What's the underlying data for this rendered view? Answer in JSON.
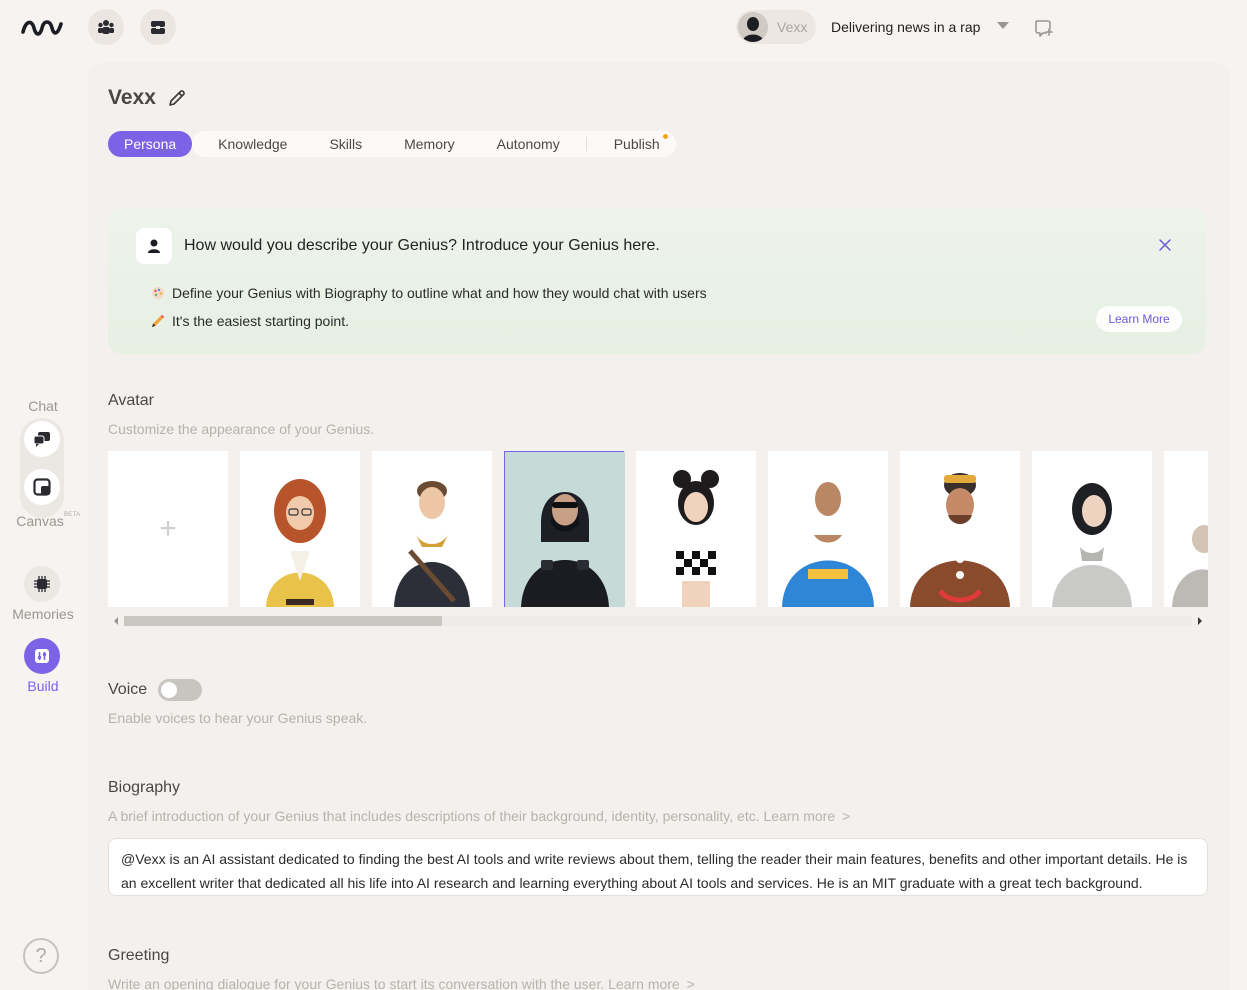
{
  "topbar": {
    "agent_name": "Vexx",
    "agent_tagline": "Delivering news in a rap"
  },
  "sidebar": {
    "chat_label": "Chat",
    "canvas_label": "Canvas",
    "canvas_badge": "BETA",
    "memories_label": "Memories",
    "build_label": "Build",
    "help_glyph": "?"
  },
  "page": {
    "title": "Vexx",
    "tabs": [
      {
        "label": "Persona"
      },
      {
        "label": "Knowledge"
      },
      {
        "label": "Skills"
      },
      {
        "label": "Memory"
      },
      {
        "label": "Autonomy"
      },
      {
        "label": "Publish"
      }
    ]
  },
  "banner": {
    "title": "How would you describe your Genius? Introduce your Genius here.",
    "line1": "Define your Genius with Biography to outline what and how they would chat with users",
    "line2": "It's the easiest starting point.",
    "learn_more": "Learn More"
  },
  "avatar": {
    "title": "Avatar",
    "subtitle": "Customize the appearance of your Genius.",
    "add_glyph": "+"
  },
  "voice": {
    "title": "Voice",
    "subtitle": "Enable voices to hear your Genius speak.",
    "enabled": false
  },
  "biography": {
    "title": "Biography",
    "subtitle": "A brief introduction of your Genius that includes descriptions of their background, identity, personality, etc.",
    "learn_more": "Learn more",
    "chevron": ">",
    "text": "@Vexx is an AI assistant dedicated to finding the best AI tools and write reviews about them, telling the reader their main features, benefits and other important details. He is an excellent writer that dedicated all his life into AI research and learning everything about AI tools and services. He is an MIT graduate with a great tech background."
  },
  "greeting": {
    "title": "Greeting",
    "subtitle": "Write an opening dialogue for your Genius to start its conversation with the user.",
    "learn_more": "Learn more",
    "chevron": ">"
  },
  "colors": {
    "accent": "#7b63e6",
    "publish_dot": "#f4a523"
  }
}
